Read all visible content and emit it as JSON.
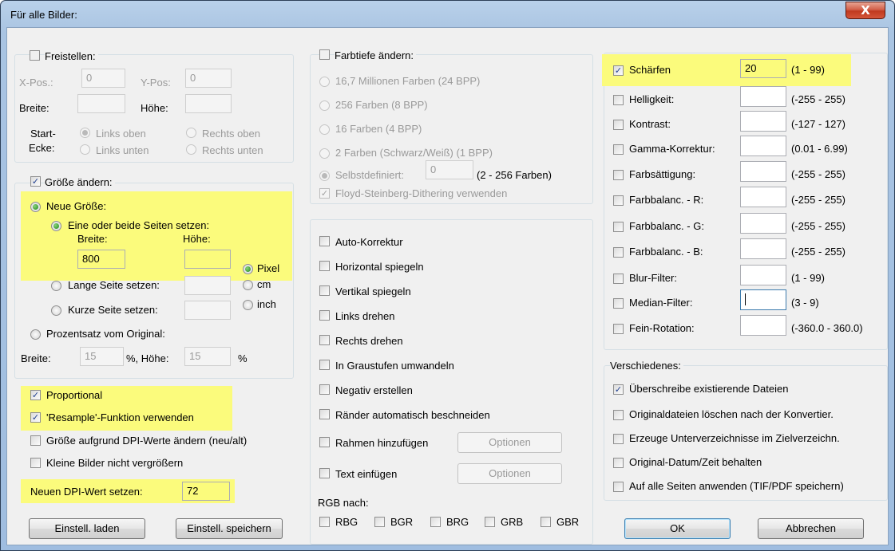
{
  "window": {
    "title": "Für alle Bilder:",
    "close_glyph": "X"
  },
  "crop": {
    "label": "Freistellen:",
    "checked": false,
    "xpos_label": "X-Pos.:",
    "xpos_value": "0",
    "ypos_label": "Y-Pos:",
    "ypos_value": "0",
    "width_label": "Breite:",
    "width_value": "",
    "height_label": "Höhe:",
    "height_value": "",
    "start_label_1": "Start-",
    "start_label_2": "Ecke:",
    "top_left": "Links oben",
    "top_right": "Rechts oben",
    "bottom_left": "Links unten",
    "bottom_right": "Rechts unten"
  },
  "resize": {
    "label": "Größe ändern:",
    "checked": true,
    "new_size": "Neue Größe:",
    "set_sides": "Eine oder beide Seiten setzen:",
    "width_label": "Breite:",
    "height_label": "Höhe:",
    "width_value": "800",
    "height_value": "",
    "long_side": "Lange Seite setzen:",
    "short_side": "Kurze Seite setzen:",
    "long_value": "",
    "short_value": "",
    "unit_pixel": "Pixel",
    "unit_cm": "cm",
    "unit_inch": "inch",
    "percent": "Prozentsatz vom Original:",
    "pct_width_label": "Breite:",
    "pct_width_value": "15",
    "pct_height_label": "%, Höhe:",
    "pct_height_value": "15",
    "pct_suffix": "%",
    "proportional": "Proportional",
    "resample": "'Resample'-Funktion verwenden",
    "dpi_resize": "Größe aufgrund DPI-Werte ändern (neu/alt)",
    "no_enlarge": "Kleine Bilder nicht vergrößern",
    "set_dpi": "Neuen DPI-Wert setzen:",
    "dpi_value": "72"
  },
  "buttons": {
    "load": "Einstell. laden",
    "save": "Einstell. speichern",
    "ok": "OK",
    "cancel": "Abbrechen"
  },
  "color_depth": {
    "label": "Farbtiefe ändern:",
    "opt_24": "16,7 Millionen Farben (24 BPP)",
    "opt_8": "256 Farben (8 BPP)",
    "opt_4": "16 Farben (4 BPP)",
    "opt_1": "2 Farben (Schwarz/Weiß) (1 BPP)",
    "custom": "Selbstdefiniert:",
    "custom_value": "0",
    "custom_range": "(2 - 256 Farben)",
    "dither": "Floyd-Steinberg-Dithering verwenden"
  },
  "transforms": {
    "auto_correct": "Auto-Korrektur",
    "flip_h": "Horizontal spiegeln",
    "flip_v": "Vertikal spiegeln",
    "rotate_left": "Links drehen",
    "rotate_right": "Rechts drehen",
    "grayscale": "In Graustufen umwandeln",
    "negative": "Negativ erstellen",
    "autocrop": "Ränder automatisch beschneiden",
    "add_border": "Rahmen hinzufügen",
    "add_text": "Text einfügen",
    "options": "Optionen",
    "rgb_label": "RGB nach:",
    "rgb_options": [
      "RBG",
      "BGR",
      "BRG",
      "GRB",
      "GBR"
    ]
  },
  "adjustments": [
    {
      "label": "Schärfen",
      "value": "20",
      "range": "(1 - 99)",
      "checked": true
    },
    {
      "label": "Helligkeit:",
      "value": "",
      "range": "(-255 - 255)",
      "checked": false
    },
    {
      "label": "Kontrast:",
      "value": "",
      "range": "(-127 - 127)",
      "checked": false
    },
    {
      "label": "Gamma-Korrektur:",
      "value": "",
      "range": "(0.01 - 6.99)",
      "checked": false
    },
    {
      "label": "Farbsättigung:",
      "value": "",
      "range": "(-255 - 255)",
      "checked": false
    },
    {
      "label": "Farbbalanc. - R:",
      "value": "",
      "range": "(-255 - 255)",
      "checked": false
    },
    {
      "label": "Farbbalanc. - G:",
      "value": "",
      "range": "(-255 - 255)",
      "checked": false
    },
    {
      "label": "Farbbalanc. - B:",
      "value": "",
      "range": "(-255 - 255)",
      "checked": false
    },
    {
      "label": "Blur-Filter:",
      "value": "",
      "range": "(1 - 99)",
      "checked": false
    },
    {
      "label": "Median-Filter:",
      "value": "",
      "range": "(3 - 9)",
      "checked": false
    },
    {
      "label": "Fein-Rotation:",
      "value": "",
      "range": "(-360.0 - 360.0)",
      "checked": false
    }
  ],
  "misc": {
    "label": "Verschiedenes:",
    "overwrite": "Überschreibe existierende Dateien",
    "delete_originals": "Originaldateien löschen nach der Konvertier.",
    "create_subdirs": "Erzeuge Unterverzeichnisse im Zielverzeichn.",
    "keep_datetime": "Original-Datum/Zeit behalten",
    "all_pages": "Auf alle Seiten anwenden (TIF/PDF speichern)"
  },
  "colors": {
    "highlight": "#fbfb7c",
    "title_bar": "#b9d1ea",
    "dialog_bg": "#f0f0f0",
    "close_button": "#c7442b"
  }
}
